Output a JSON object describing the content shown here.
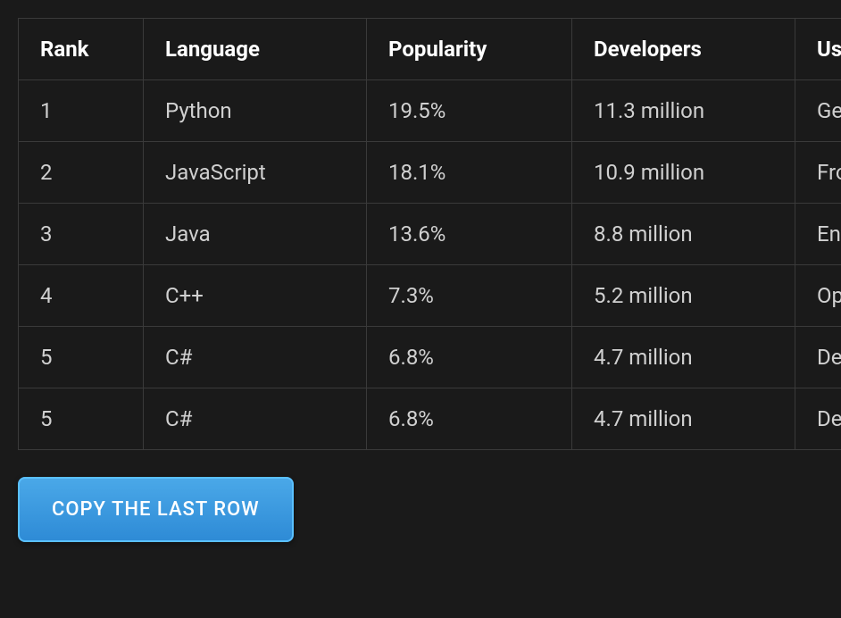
{
  "table": {
    "headers": [
      "Rank",
      "Language",
      "Popularity",
      "Developers",
      "Use Case"
    ],
    "rows": [
      {
        "rank": "1",
        "language": "Python",
        "popularity": "19.5%",
        "developers": "11.3 million",
        "use_case": "General"
      },
      {
        "rank": "2",
        "language": "JavaScript",
        "popularity": "18.1%",
        "developers": "10.9 million",
        "use_case": "Front-end"
      },
      {
        "rank": "3",
        "language": "Java",
        "popularity": "13.6%",
        "developers": "8.8 million",
        "use_case": "Enterprise"
      },
      {
        "rank": "4",
        "language": "C++",
        "popularity": "7.3%",
        "developers": "5.2 million",
        "use_case": "Operating"
      },
      {
        "rank": "5",
        "language": "C#",
        "popularity": "6.8%",
        "developers": "4.7 million",
        "use_case": "Desktop"
      },
      {
        "rank": "5",
        "language": "C#",
        "popularity": "6.8%",
        "developers": "4.7 million",
        "use_case": "Desktop"
      }
    ]
  },
  "button": {
    "copy_last_row": "COPY THE LAST ROW"
  }
}
